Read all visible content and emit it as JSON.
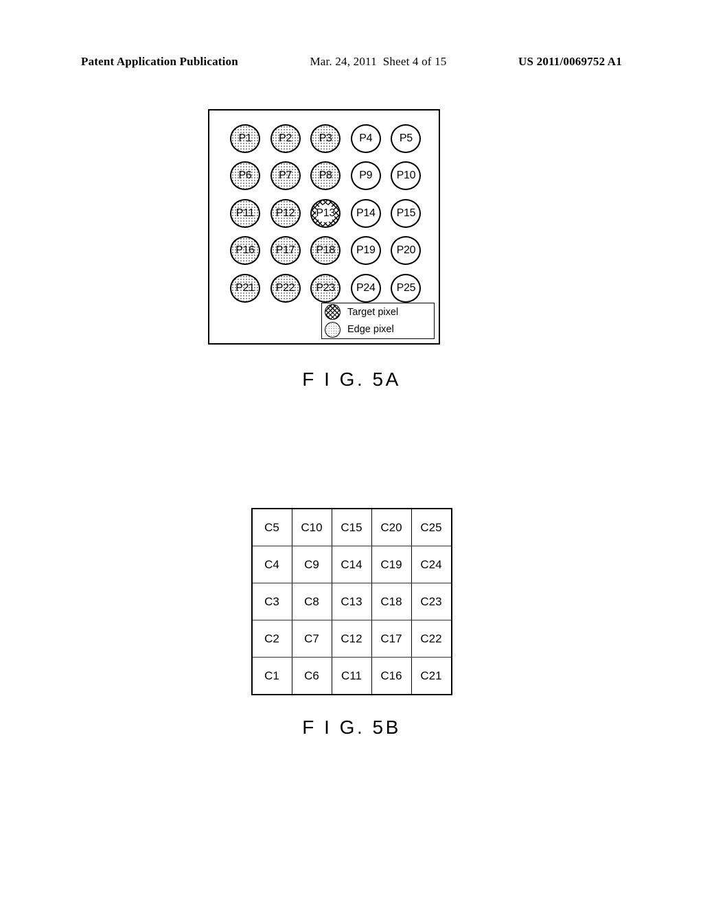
{
  "header": {
    "pubtype": "Patent Application Publication",
    "date": "Mar. 24, 2011",
    "sheet": "Sheet 4 of 15",
    "pubnum": "US 2011/0069752 A1"
  },
  "fig5a": {
    "label": "F I G. 5A",
    "legend": {
      "target": "Target pixel",
      "edge": "Edge pixel"
    },
    "pixels": [
      {
        "label": "P1",
        "type": "edge"
      },
      {
        "label": "P2",
        "type": "edge"
      },
      {
        "label": "P3",
        "type": "edge"
      },
      {
        "label": "P4",
        "type": "plain"
      },
      {
        "label": "P5",
        "type": "plain"
      },
      {
        "label": "P6",
        "type": "edge"
      },
      {
        "label": "P7",
        "type": "edge"
      },
      {
        "label": "P8",
        "type": "edge"
      },
      {
        "label": "P9",
        "type": "plain"
      },
      {
        "label": "P10",
        "type": "plain"
      },
      {
        "label": "P11",
        "type": "edge"
      },
      {
        "label": "P12",
        "type": "edge"
      },
      {
        "label": "P13",
        "type": "target"
      },
      {
        "label": "P14",
        "type": "plain"
      },
      {
        "label": "P15",
        "type": "plain"
      },
      {
        "label": "P16",
        "type": "edge"
      },
      {
        "label": "P17",
        "type": "edge"
      },
      {
        "label": "P18",
        "type": "edge"
      },
      {
        "label": "P19",
        "type": "plain"
      },
      {
        "label": "P20",
        "type": "plain"
      },
      {
        "label": "P21",
        "type": "edge"
      },
      {
        "label": "P22",
        "type": "edge"
      },
      {
        "label": "P23",
        "type": "edge"
      },
      {
        "label": "P24",
        "type": "plain"
      },
      {
        "label": "P25",
        "type": "plain"
      }
    ]
  },
  "fig5b": {
    "label": "F I G. 5B",
    "rows": [
      [
        "C5",
        "C10",
        "C15",
        "C20",
        "C25"
      ],
      [
        "C4",
        "C9",
        "C14",
        "C19",
        "C24"
      ],
      [
        "C3",
        "C8",
        "C13",
        "C18",
        "C23"
      ],
      [
        "C2",
        "C7",
        "C12",
        "C17",
        "C22"
      ],
      [
        "C1",
        "C6",
        "C11",
        "C16",
        "C21"
      ]
    ]
  }
}
